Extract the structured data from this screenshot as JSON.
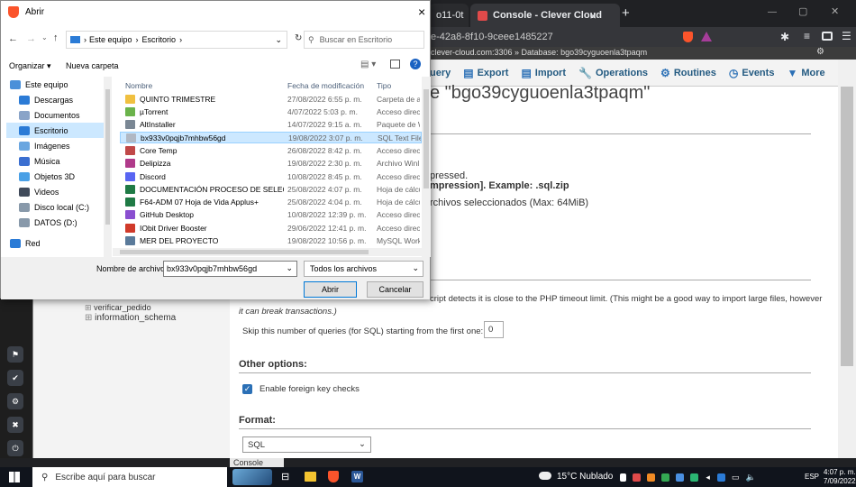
{
  "browser": {
    "tabs": [
      {
        "label": "o11-0t"
      },
      {
        "label": "Console - Clever Cloud"
      }
    ],
    "tab_close": "×",
    "new_tab": "+",
    "address": "e-42a8-8f10-9ceee1485227",
    "window_controls": {
      "minimize": "—",
      "maximize": "▢",
      "close": "✕"
    }
  },
  "pma": {
    "breadcrumb": "clever-cloud.com:3306 » Database: bgo39cyguoenla3tpaqm",
    "tabs": [
      {
        "label": "uery",
        "icon": "query-icon"
      },
      {
        "label": "Export",
        "icon": "export-icon"
      },
      {
        "label": "Import",
        "icon": "import-icon"
      },
      {
        "label": "Operations",
        "icon": "wrench-icon"
      },
      {
        "label": "Routines",
        "icon": "routines-icon"
      },
      {
        "label": "Events",
        "icon": "clock-icon"
      },
      {
        "label": "More",
        "icon": "chevron-down-icon"
      }
    ],
    "title": "e \"bgo39cyguoenla3tpaqm\"",
    "compressed_line1": "pressed.",
    "compressed_line2": "mpression]. Example: .sql.zip",
    "selected_files": "rchivos seleccionados (Max: 64MiB)",
    "timeout_text": "cript detects it is close to the PHP timeout limit. (This might be a good way to import large files, however",
    "timeout_text2": "it can break transactions.)",
    "skip_label": "Skip this number of queries (for SQL) starting from the first one:",
    "skip_value": "0",
    "other_options": "Other options:",
    "foreign_keys": "Enable foreign key checks",
    "format_heading": "Format:",
    "format_value": "SQL",
    "console_label": "Console"
  },
  "sidebar": {
    "tree": [
      {
        "label": "verificar_pedido"
      },
      {
        "label": "information_schema"
      }
    ]
  },
  "dialog": {
    "title": "Abrir",
    "close": "×",
    "path": [
      "Este equipo",
      "Escritorio"
    ],
    "search_placeholder": "Buscar en Escritorio",
    "organize": "Organizar ▾",
    "new_folder": "Nueva carpeta",
    "nav": [
      {
        "label": "Este equipo",
        "color": "#4a90d9"
      },
      {
        "label": "Descargas",
        "color": "#2b7bd6"
      },
      {
        "label": "Documentos",
        "color": "#8aa4c8"
      },
      {
        "label": "Escritorio",
        "color": "#2b7bd6"
      },
      {
        "label": "Imágenes",
        "color": "#6aa6e0"
      },
      {
        "label": "Música",
        "color": "#3b6fd0"
      },
      {
        "label": "Objetos 3D",
        "color": "#4aa0e6"
      },
      {
        "label": "Videos",
        "color": "#404a5a"
      },
      {
        "label": "Disco local (C:)",
        "color": "#8899aa"
      },
      {
        "label": "DATOS (D:)",
        "color": "#8899aa"
      },
      {
        "label": "Red",
        "color": "#2b7bd6"
      }
    ],
    "columns": {
      "name": "Nombre",
      "date": "Fecha de modificación",
      "type": "Tipo"
    },
    "files": [
      {
        "name": "QUINTO TRIMESTRE",
        "date": "27/08/2022 6:55 p. m.",
        "type": "Carpeta de ar",
        "color": "#f0c040"
      },
      {
        "name": "µTorrent",
        "date": "4/07/2022 5:03 p. m.",
        "type": "Acceso direc",
        "color": "#6bb34b"
      },
      {
        "name": "AltInstaller",
        "date": "14/07/2022 9:15 a. m.",
        "type": "Paquete de W",
        "color": "#7a8794"
      },
      {
        "name": "bx933v0pqjb7mhbw56gd",
        "date": "19/08/2022 3:07 p. m.",
        "type": "SQL Text File",
        "color": "#b0b8c4",
        "selected": true
      },
      {
        "name": "Core Temp",
        "date": "26/08/2022 8:42 p. m.",
        "type": "Acceso direc",
        "color": "#c04848"
      },
      {
        "name": "Delipizza",
        "date": "19/08/2022 2:30 p. m.",
        "type": "Archivo Winl",
        "color": "#b03a8a"
      },
      {
        "name": "Discord",
        "date": "10/08/2022 8:45 p. m.",
        "type": "Acceso direc",
        "color": "#5865f2"
      },
      {
        "name": "DOCUMENTACIÓN PROCESO DE SELECC...",
        "date": "25/08/2022 4:07 p. m.",
        "type": "Hoja de cálcu",
        "color": "#1f7a45"
      },
      {
        "name": "F64-ADM 07 Hoja de Vida Applus+",
        "date": "25/08/2022 4:04 p. m.",
        "type": "Hoja de cálcu",
        "color": "#1f7a45"
      },
      {
        "name": "GitHub Desktop",
        "date": "10/08/2022 12:39 p. m.",
        "type": "Acceso direc",
        "color": "#8a4fd0"
      },
      {
        "name": "IObit Driver Booster",
        "date": "29/06/2022 12:41 p. m.",
        "type": "Acceso direc",
        "color": "#d03a2a"
      },
      {
        "name": "MER DEL PROYECTO",
        "date": "19/08/2022 10:56 p. m.",
        "type": "MySQL Work",
        "color": "#5a7a9a"
      }
    ],
    "filename_label": "Nombre de archivo:",
    "filename_value": "bx933v0pqjb7mhbw56gd",
    "filter": "Todos los archivos",
    "open_button": "Abrir",
    "cancel_button": "Cancelar"
  },
  "taskbar": {
    "search_placeholder": "Escribe aquí para buscar",
    "weather": "15°C Nublado",
    "lang": "ESP",
    "time": "4:07 p. m.",
    "date": "7/09/2022"
  },
  "colors": {
    "accent": "#0078d7",
    "pma_link": "#235a81",
    "brave": "#fb542b"
  }
}
